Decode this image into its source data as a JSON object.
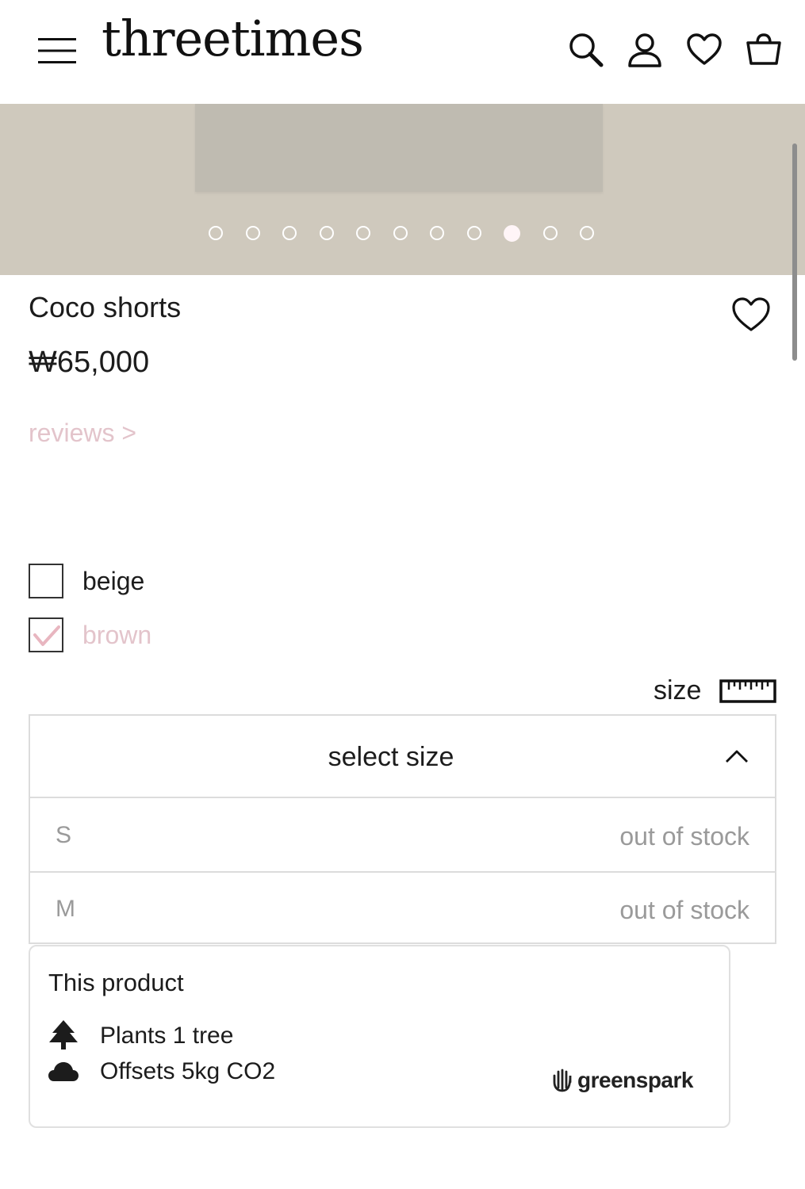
{
  "header": {
    "logo": "threetimes",
    "icons": [
      "menu-icon",
      "search-icon",
      "account-icon",
      "wishlist-icon",
      "cart-icon"
    ]
  },
  "gallery": {
    "slide_count": 11,
    "active_index": 8,
    "background_color": "#cfc9bd"
  },
  "product": {
    "title": "Coco shorts",
    "price": "₩65,000",
    "reviews_link": "reviews >",
    "accent_color": "#e3c4cb"
  },
  "colors": {
    "options": [
      {
        "label": "beige",
        "checked": false
      },
      {
        "label": "brown",
        "checked": true
      }
    ]
  },
  "size": {
    "label": "size",
    "dropdown_placeholder": "select size",
    "options": [
      {
        "name": "S",
        "status": "out of stock"
      },
      {
        "name": "M",
        "status": "out of stock"
      }
    ]
  },
  "impact": {
    "title": "This product",
    "lines": [
      "Plants 1 tree",
      "Offsets 5kg CO2"
    ],
    "brand": "greenspark"
  }
}
